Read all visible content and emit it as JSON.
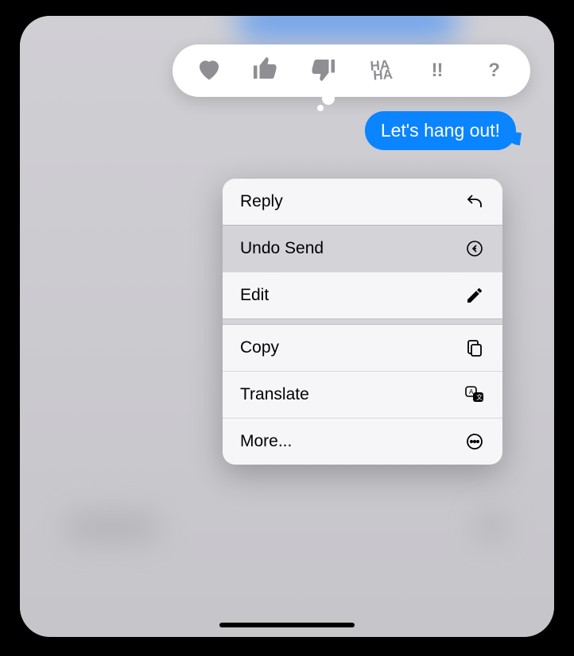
{
  "message": {
    "text": "Let's hang out!"
  },
  "tapbacks": {
    "heart": "heart",
    "thumbs_up": "thumbs-up",
    "thumbs_down": "thumbs-down",
    "haha_line1": "HA",
    "haha_line2": "HA",
    "exclaim": "!!",
    "question": "?"
  },
  "menu": {
    "reply": "Reply",
    "undo_send": "Undo Send",
    "edit": "Edit",
    "copy": "Copy",
    "translate": "Translate",
    "more": "More..."
  },
  "colors": {
    "bubble": "#0a84ff",
    "tapback_icon": "#8e8e93"
  }
}
